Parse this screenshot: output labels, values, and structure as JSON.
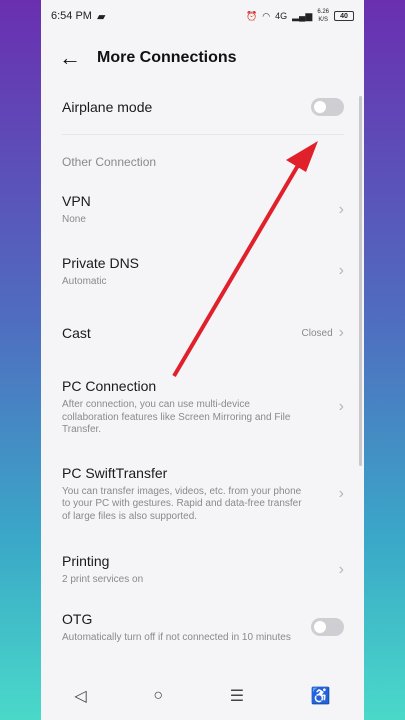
{
  "status_bar": {
    "time": "6:54 PM",
    "network": "4G",
    "speed_value": "6.26",
    "speed_unit": "K/S",
    "battery": "40"
  },
  "header": {
    "title": "More Connections"
  },
  "airplane": {
    "label": "Airplane mode",
    "enabled": false
  },
  "section": {
    "label": "Other Connection"
  },
  "items": [
    {
      "title": "VPN",
      "sub": "None"
    },
    {
      "title": "Private DNS",
      "sub": "Automatic"
    },
    {
      "title": "Cast",
      "value": "Closed"
    },
    {
      "title": "PC Connection",
      "sub": "After connection, you can use multi-device collaboration features like Screen Mirroring and File Transfer."
    },
    {
      "title": "PC SwiftTransfer",
      "sub": "You can transfer images, videos, etc. from your phone to your PC with gestures. Rapid and data-free transfer of large files is also supported."
    },
    {
      "title": "Printing",
      "sub": "2 print services on"
    },
    {
      "title": "OTG",
      "sub": "Automatically turn off if not connected in 10 minutes"
    }
  ],
  "icons": [
    "back-icon",
    "chevron-right-icon",
    "alarm-icon",
    "wifi-icon",
    "video-icon",
    "nav-back-icon",
    "nav-home-icon",
    "nav-menu-icon",
    "accessibility-icon"
  ],
  "annotation_color": "#e0202a"
}
